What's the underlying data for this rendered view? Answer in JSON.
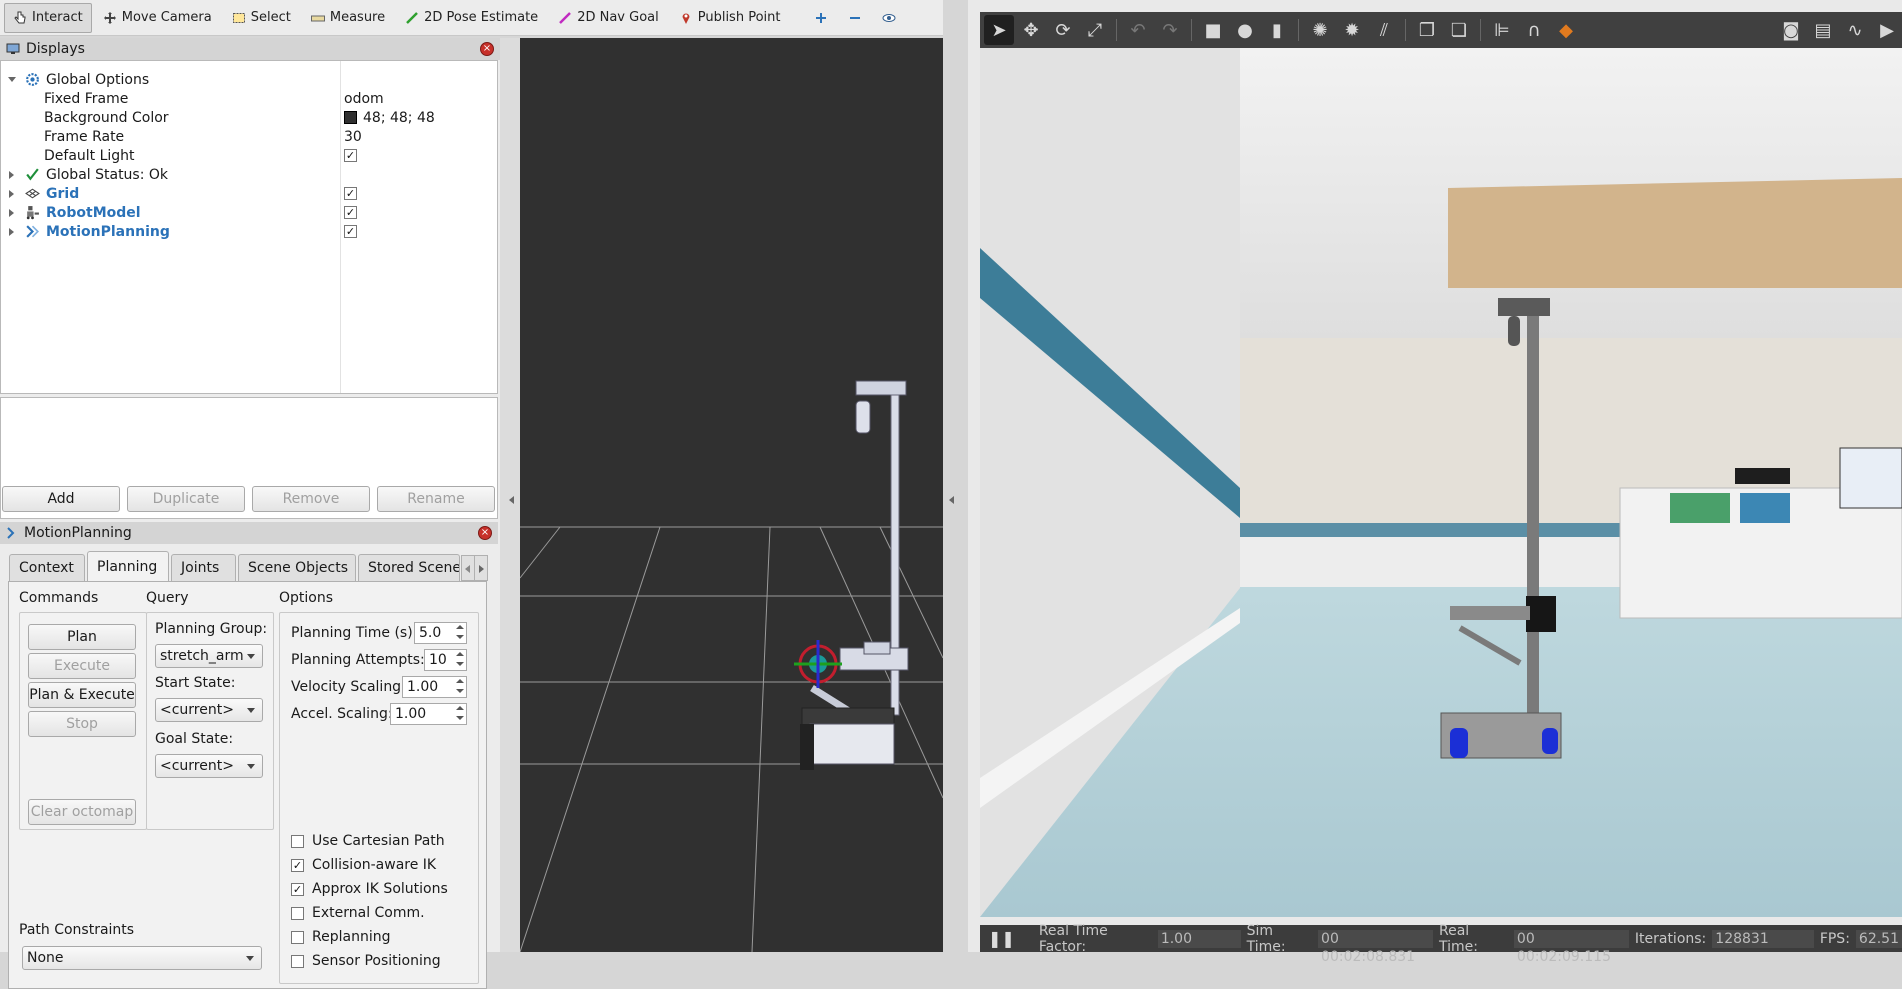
{
  "rviz_toolbar": {
    "tools": [
      {
        "label": "Interact",
        "icon": "hand-pointer-icon"
      },
      {
        "label": "Move Camera",
        "icon": "move-camera-icon"
      },
      {
        "label": "Select",
        "icon": "select-icon"
      },
      {
        "label": "Measure",
        "icon": "measure-icon"
      },
      {
        "label": "2D Pose Estimate",
        "icon": "pose-estimate-icon"
      },
      {
        "label": "2D Nav Goal",
        "icon": "nav-goal-icon"
      },
      {
        "label": "Publish Point",
        "icon": "publish-point-icon"
      }
    ],
    "extra_icons": [
      "plus-icon",
      "minus-icon",
      "eye-icon"
    ]
  },
  "displays": {
    "title": "Displays",
    "rows": [
      {
        "name": "Global Options"
      },
      {
        "name": "Fixed Frame",
        "value": "odom"
      },
      {
        "name": "Background Color",
        "value": "48; 48; 48"
      },
      {
        "name": "Frame Rate",
        "value": "30"
      },
      {
        "name": "Default Light",
        "checked": true
      },
      {
        "name": "Global Status: Ok"
      },
      {
        "name": "Grid",
        "checked": true
      },
      {
        "name": "RobotModel",
        "checked": true
      },
      {
        "name": "MotionPlanning",
        "checked": true
      }
    ],
    "buttons": {
      "add": "Add",
      "duplicate": "Duplicate",
      "remove": "Remove",
      "rename": "Rename"
    }
  },
  "motion_planning": {
    "title": "MotionPlanning",
    "tabs": [
      "Context",
      "Planning",
      "Joints",
      "Scene Objects",
      "Stored Scene"
    ],
    "commands": {
      "title": "Commands",
      "plan": "Plan",
      "execute": "Execute",
      "plan_execute": "Plan & Execute",
      "stop": "Stop",
      "clear_octomap": "Clear octomap"
    },
    "query": {
      "title": "Query",
      "planning_group_label": "Planning Group:",
      "planning_group": "stretch_arm",
      "start_state_label": "Start State:",
      "start_state": "<current>",
      "goal_state_label": "Goal State:",
      "goal_state": "<current>"
    },
    "options": {
      "title": "Options",
      "planning_time_label": "Planning Time (s):",
      "planning_time": "5.0",
      "planning_attempts_label": "Planning Attempts:",
      "planning_attempts": "10",
      "velocity_scaling_label": "Velocity Scaling:",
      "velocity_scaling": "1.00",
      "accel_scaling_label": "Accel. Scaling:",
      "accel_scaling": "1.00",
      "checkboxes": [
        {
          "label": "Use Cartesian Path",
          "checked": false
        },
        {
          "label": "Collision-aware IK",
          "checked": true
        },
        {
          "label": "Approx IK Solutions",
          "checked": true
        },
        {
          "label": "External Comm.",
          "checked": false
        },
        {
          "label": "Replanning",
          "checked": false
        },
        {
          "label": "Sensor Positioning",
          "checked": false
        }
      ]
    },
    "path_constraints": {
      "label": "Path Constraints",
      "value": "None"
    }
  },
  "gazebo": {
    "status": {
      "real_time_factor_label": "Real Time Factor:",
      "real_time_factor": "1.00",
      "sim_time_label": "Sim Time:",
      "sim_time": "00 00:02:08.831",
      "real_time_label": "Real Time:",
      "real_time": "00 00:02:09.115",
      "iterations_label": "Iterations:",
      "iterations": "128831",
      "fps_label": "FPS:",
      "fps": "62.51"
    }
  },
  "colors": {
    "rviz_background": "#303030",
    "link_blue": "#2b72b8",
    "close_red": "#c7302a",
    "gazebo_toolbar": "#404040"
  }
}
